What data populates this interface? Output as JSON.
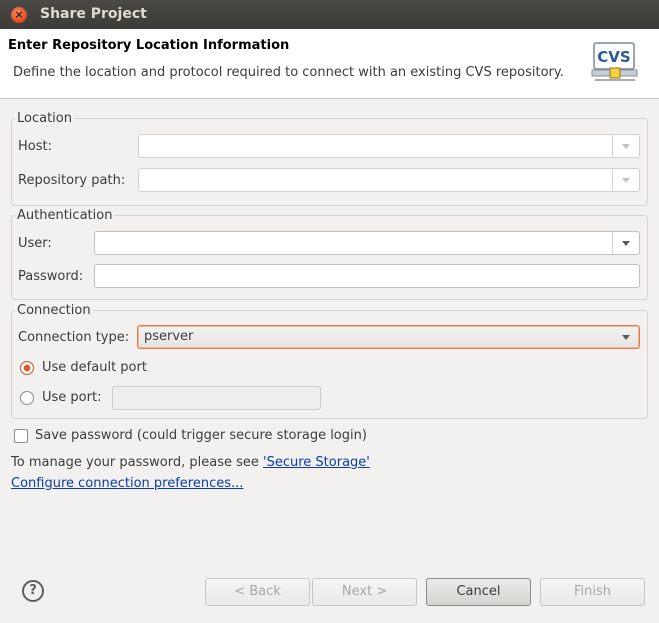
{
  "window": {
    "title": "Share Project",
    "close_glyph": "×"
  },
  "header": {
    "title": "Enter Repository Location Information",
    "description": "Define the location and protocol required to connect with an existing CVS repository.",
    "icon": "cvs-repository-icon",
    "icon_text": "CVS"
  },
  "location": {
    "legend": "Location",
    "host_label": "Host:",
    "host_value": "",
    "repository_path_label": "Repository path:",
    "repository_path_value": ""
  },
  "authentication": {
    "legend": "Authentication",
    "user_label": "User:",
    "user_value": "",
    "password_label": "Password:",
    "password_value": ""
  },
  "connection": {
    "legend": "Connection",
    "connection_type_label": "Connection type:",
    "connection_type_value": "pserver",
    "use_default_port_label": "Use default port",
    "use_default_port_checked": true,
    "use_port_label": "Use port:",
    "port_value": ""
  },
  "options": {
    "save_password_label": "Save password (could trigger secure storage login)",
    "save_password_checked": false,
    "manage_password_text": "To manage your password, please see ",
    "secure_storage_link": "'Secure Storage'",
    "configure_link": "Configure connection preferences..."
  },
  "footer": {
    "help_glyph": "?",
    "back_label": "< Back",
    "next_label": "Next >",
    "cancel_label": "Cancel",
    "finish_label": "Finish"
  },
  "colors": {
    "accent": "#e0571f",
    "link": "#0b3ca8",
    "titlebar": "#3c3b37"
  }
}
